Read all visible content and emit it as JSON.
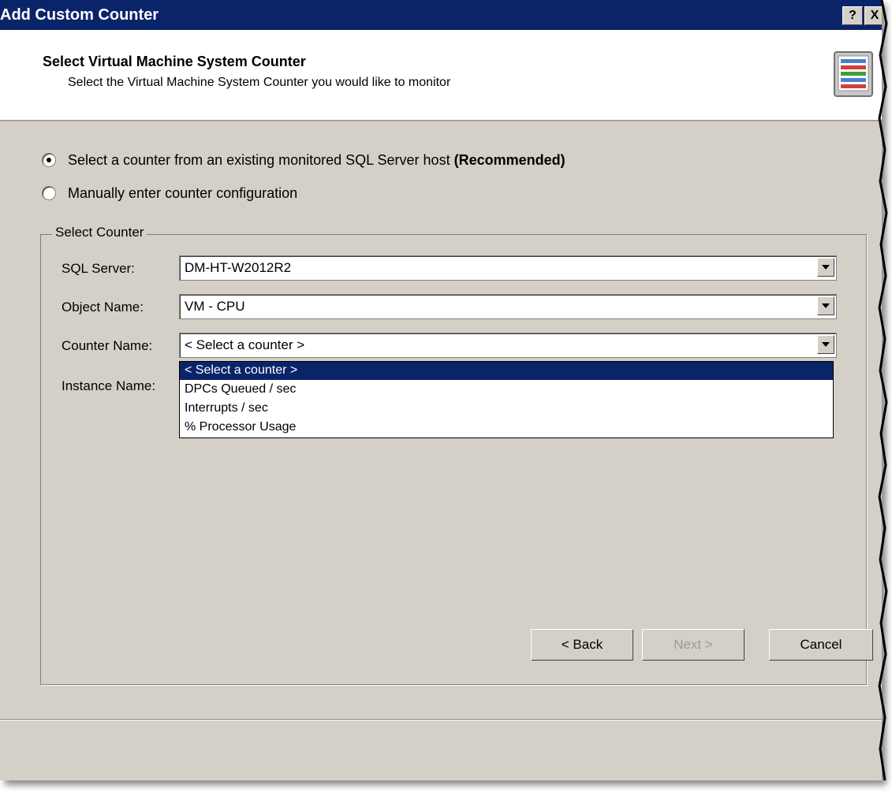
{
  "window": {
    "title": "Add Custom Counter",
    "help_button": "?",
    "close_button": "X"
  },
  "header": {
    "title": "Select Virtual Machine System Counter",
    "subtitle": "Select the Virtual Machine System Counter you would like to monitor",
    "icon": "counter-wizard-icon"
  },
  "options": {
    "existing_label": "Select a counter from an existing monitored SQL Server host",
    "existing_suffix": "(Recommended)",
    "existing_selected": true,
    "manual_label": "Manually enter counter configuration",
    "manual_selected": false
  },
  "group": {
    "legend": "Select Counter",
    "fields": {
      "sql_server_label": "SQL Server:",
      "sql_server_value": "DM-HT-W2012R2",
      "object_name_label": "Object Name:",
      "object_name_value": "VM - CPU",
      "counter_name_label": "Counter Name:",
      "counter_name_value": "< Select a counter >",
      "instance_name_label": "Instance Name:"
    },
    "counter_options": [
      "< Select a counter >",
      "DPCs Queued / sec",
      "Interrupts / sec",
      "% Processor Usage"
    ]
  },
  "footer": {
    "back": "< Back",
    "next": "Next >",
    "cancel": "Cancel"
  },
  "colors": {
    "titlebar": "#0a246a",
    "selection": "#0a246a",
    "dialog_bg": "#d4d0c8"
  }
}
